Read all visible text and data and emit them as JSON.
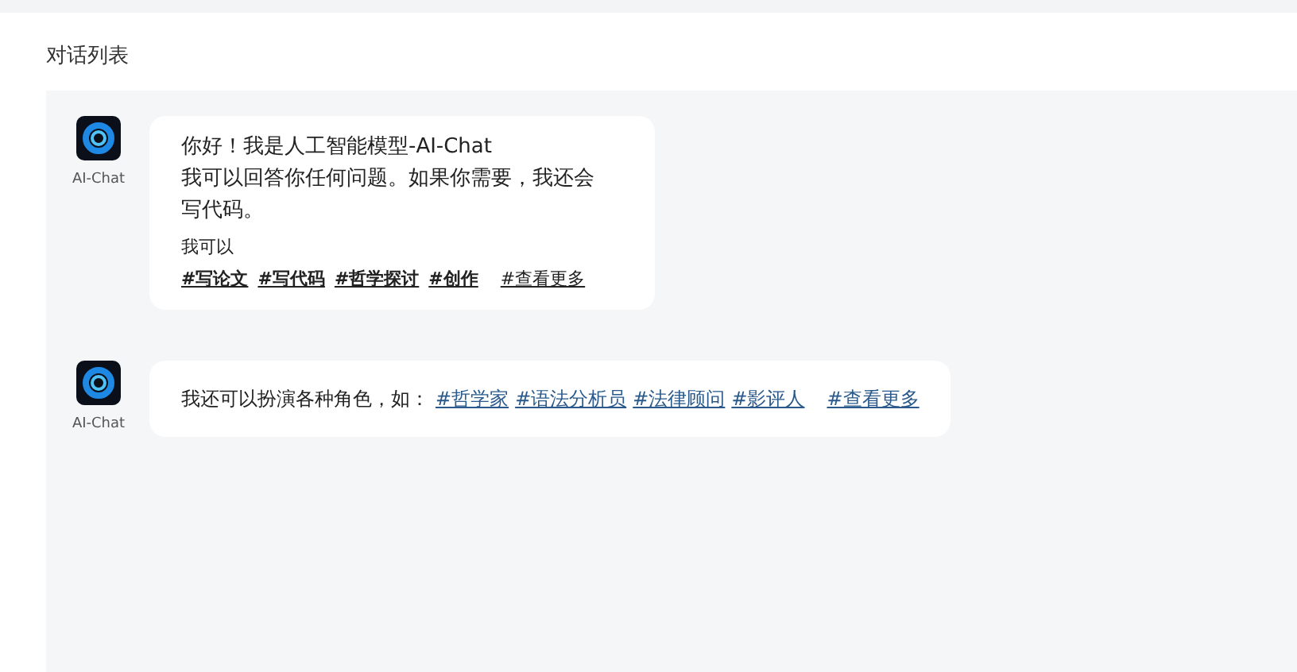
{
  "title": "对话列表",
  "messages": [
    {
      "kind": "tag-block",
      "sender": "AI-Chat",
      "lines": [
        "你好！我是人工智能模型-AI-Chat",
        "我可以回答你任何问题。如果你需要，我还会写代码。"
      ],
      "intro": "我可以",
      "tags": [
        "#写论文",
        "#写代码",
        "#哲学探讨",
        "#创作"
      ],
      "more": "#查看更多"
    },
    {
      "kind": "inline-links",
      "sender": "AI-Chat",
      "lines": [
        "我还可以扮演各种角色，如："
      ],
      "tags": [
        "#哲学家",
        "#语法分析员",
        "#法律顾问",
        "#影评人"
      ],
      "more": "#查看更多"
    }
  ]
}
